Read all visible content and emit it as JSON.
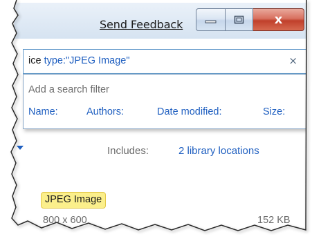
{
  "window": {
    "feedback_link": "Send Feedback",
    "close_glyph": "x"
  },
  "search": {
    "query_word": "ice",
    "query_filter": "type:\"JPEG Image\"",
    "clear_glyph": "×"
  },
  "filter_dropdown": {
    "hint": "Add a search filter",
    "filters": [
      "Name:",
      "Authors:",
      "Date modified:",
      "Size:"
    ]
  },
  "library": {
    "includes_label": "Includes:",
    "includes_link": "2 library locations"
  },
  "result": {
    "type_highlight": "JPEG Image",
    "dimensions": "800 x 600",
    "size": "152 KB"
  },
  "colors": {
    "link": "#1f5fc0",
    "highlight": "#fbef8b",
    "close_button": "#c0402b"
  }
}
